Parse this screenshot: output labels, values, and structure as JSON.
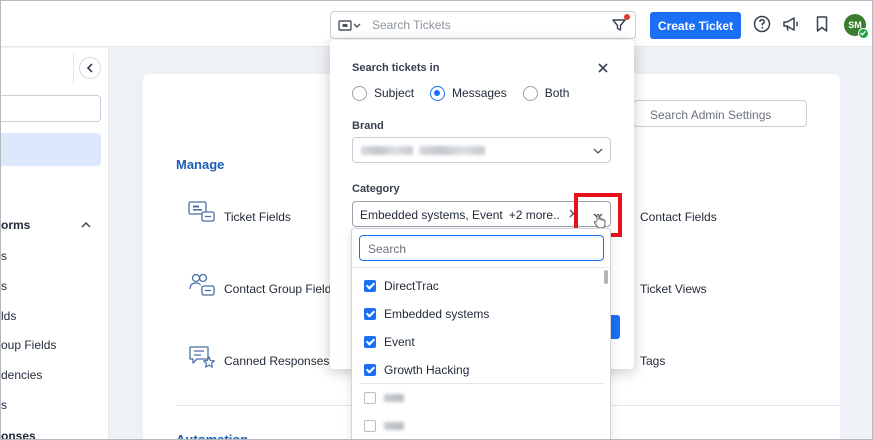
{
  "topbar": {
    "search_placeholder": "Search Tickets",
    "create_ticket_label": "Create Ticket",
    "avatar_initials": "SM",
    "accent_color": "#1a6ff5"
  },
  "sidebar": {
    "partial_labels": [
      "orms",
      "s",
      "s",
      "lds",
      "oup Fields",
      "dencies",
      "s",
      "onses"
    ]
  },
  "main": {
    "admin_search_placeholder": "Search Admin Settings",
    "manage_title": "Manage",
    "automation_title": "Automation",
    "items": {
      "ticket_fields": "Ticket Fields",
      "contact_fields": "Contact Fields",
      "contact_group_fields": "Contact Group Fields",
      "ticket_views": "Ticket Views",
      "canned_responses": "Canned Responses",
      "tags": "Tags"
    }
  },
  "popover": {
    "search_in_label": "Search tickets in",
    "options": [
      "Subject",
      "Messages",
      "Both"
    ],
    "selected_option": "Messages",
    "brand_label": "Brand",
    "category_label": "Category",
    "category_value": "Embedded systems, Event",
    "category_more": "+2 more..",
    "dropdown": {
      "search_placeholder": "Search",
      "items": [
        {
          "label": "DirectTrac",
          "checked": true
        },
        {
          "label": "Embedded systems",
          "checked": true
        },
        {
          "label": "Event",
          "checked": true
        },
        {
          "label": "Growth Hacking",
          "checked": true
        }
      ]
    }
  },
  "highlight_color": "#e8111b"
}
